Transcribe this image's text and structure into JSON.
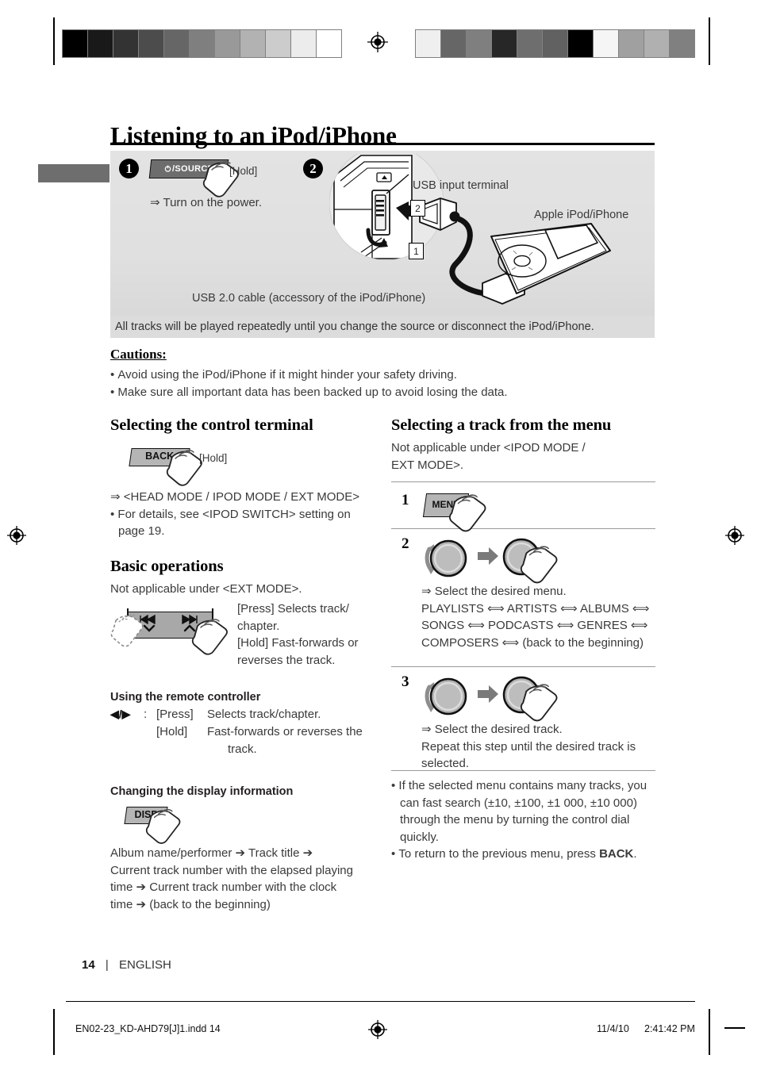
{
  "document": {
    "title": "Listening to an iPod/iPhone",
    "page_number": "14",
    "language": "ENGLISH",
    "page_separator": "|"
  },
  "hero": {
    "step1": {
      "marker": "1",
      "button_label": "/SOURCE",
      "button_icon": "power-icon",
      "hold_label": "[Hold]",
      "result_arrow": "⇒",
      "result_text": "Turn on the power."
    },
    "step2": {
      "marker": "2",
      "callout_usb": "USB input terminal",
      "callout_ipod": "Apple iPod/iPhone",
      "callout_cable": "USB 2.0 cable (accessory of the iPod/iPhone)",
      "numbox_1": "1",
      "numbox_2": "2"
    },
    "note": "All tracks will be played repeatedly until you change the source or disconnect the iPod/iPhone."
  },
  "cautions": {
    "heading": "Cautions:",
    "items": [
      "Avoid using the iPod/iPhone if it might hinder your safety driving.",
      "Make sure all important data has been backed up to avoid losing the data."
    ]
  },
  "left_column": {
    "section_terminal": {
      "heading": "Selecting the control terminal",
      "key_label": "BACK",
      "hold_label": "[Hold]",
      "result_arrow": "⇒",
      "result_text": "<HEAD MODE / IPOD MODE / EXT MODE>",
      "bullet": "For details, see <IPOD SWITCH> setting on page 19."
    },
    "section_basic": {
      "heading": "Basic operations",
      "note": "Not applicable under <EXT MODE>.",
      "press_line1": "[Press] Selects track/",
      "press_line2": "chapter.",
      "hold_line1": "[Hold] Fast-forwards or",
      "hold_line2": "reverses the track.",
      "icon_prev": "previous-track-icon",
      "icon_next": "next-track-icon",
      "icon_down": "chevron-down-icon",
      "icon_up": "chevron-up-icon"
    },
    "section_remote": {
      "heading": "Using the remote controller",
      "keys": "◀/▶",
      "colon": ":",
      "press_label": "[Press]",
      "press_text": "Selects track/chapter.",
      "hold_label": "[Hold]",
      "hold_text_l1": "Fast-forwards or reverses the",
      "hold_text_l2": "track."
    },
    "section_display": {
      "heading": "Changing the display information",
      "key_label": "DISP",
      "sequence_l1": "Album name/performer ➔ Track title ➔",
      "sequence_l2": "Current track number with the elapsed playing",
      "sequence_l3": "time ➔ Current track number with the clock",
      "sequence_l4": "time ➔ (back to the beginning)"
    }
  },
  "right_column": {
    "heading": "Selecting a track from the menu",
    "note_l1": "Not applicable under <IPOD MODE /",
    "note_l2": "EXT MODE>.",
    "steps": [
      {
        "number": "1",
        "key_label": "MENU",
        "icon": "hand-press-icon"
      },
      {
        "number": "2",
        "icon_dial_turn": "dial-turn-icon",
        "icon_dial_press": "dial-press-icon",
        "result_arrow": "⇒",
        "result_text": "Select the desired menu.",
        "menu_chain_l1": "PLAYLISTS ⟺ ARTISTS ⟺ ALBUMS ⟺",
        "menu_chain_l2": "SONGS ⟺ PODCASTS ⟺ GENRES ⟺",
        "menu_chain_l3": "COMPOSERS ⟺ (back to the beginning)"
      },
      {
        "number": "3",
        "icon_dial_turn": "dial-turn-icon",
        "icon_dial_press": "dial-press-icon",
        "result_arrow": "⇒",
        "result_text": "Select the desired track.",
        "repeat_l1": "Repeat this step until the desired track is",
        "repeat_l2": "selected."
      }
    ],
    "bullets": [
      "If the selected menu contains many tracks, you can fast search (±10, ±100, ±1 000, ±10 000) through the menu by turning the control dial quickly.",
      "To return to the previous menu, press BACK."
    ],
    "bullet2_prefix": "To return to the previous menu, press ",
    "bullet2_bold": "BACK",
    "bullet2_suffix": "."
  },
  "printer_footer": {
    "filename": "EN02-23_KD-AHD79[J]1.indd   14",
    "date": "11/4/10",
    "time": "2:41:42 PM"
  },
  "calibration": {
    "left_strip": [
      "#000000",
      "#191919",
      "#333333",
      "#4c4c4c",
      "#666666",
      "#7f7f7f",
      "#999999",
      "#b2b2b2",
      "#cccccc",
      "#ececec",
      "#ffffff"
    ],
    "right_strip": [
      "#efefef",
      "#666666",
      "#7f7f7f",
      "#272727",
      "#6e6e6e",
      "#616161",
      "#000000",
      "#f5f5f5",
      "#a0a0a0",
      "#b0b0b0",
      "#808080"
    ]
  }
}
